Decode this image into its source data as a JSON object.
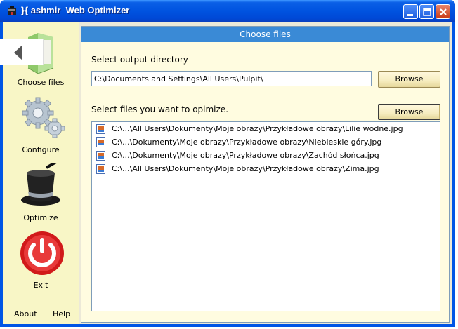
{
  "window": {
    "title": "}{ ashmir  Web Optimizer"
  },
  "sidebar": {
    "items": [
      {
        "label": "Choose files",
        "icon": "folder-icon"
      },
      {
        "label": "Configure",
        "icon": "gears-icon"
      },
      {
        "label": "Optimize",
        "icon": "magic-hat-icon"
      },
      {
        "label": "Exit",
        "icon": "power-icon"
      }
    ],
    "about_label": "About",
    "help_label": "Help"
  },
  "panel": {
    "header": "Choose files",
    "output_dir_label": "Select output directory",
    "output_dir_value": "C:\\Documents and Settings\\All Users\\Pulpit\\",
    "browse_label": "Browse",
    "files_label": "Select files you want to opimize.",
    "files_browse_label": "Browse",
    "files": [
      "C:\\...\\All Users\\Dokumenty\\Moje obrazy\\Przykładowe obrazy\\Lilie wodne.jpg",
      "C:\\...\\Dokumenty\\Moje obrazy\\Przykładowe obrazy\\Niebieskie góry.jpg",
      "C:\\...\\Dokumenty\\Moje obrazy\\Przykładowe obrazy\\Zachód słońca.jpg",
      "C:\\...\\All Users\\Dokumenty\\Moje obrazy\\Przykładowe obrazy\\Zima.jpg"
    ]
  },
  "colors": {
    "titlebar": "#0053e0",
    "sidebar_bg": "#f8f6c6",
    "panel_header": "#3a8ad6",
    "panel_bg": "#fffce0"
  }
}
